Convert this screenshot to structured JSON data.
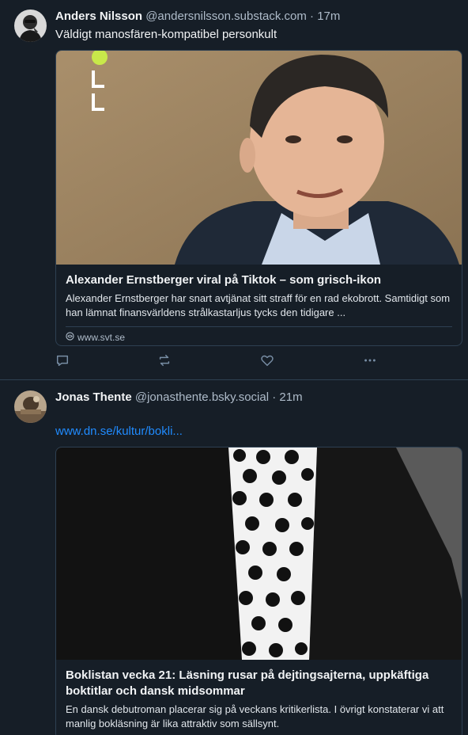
{
  "posts": [
    {
      "author": "Anders Nilsson",
      "handle": "@andersnilsson.substack.com",
      "separator": "·",
      "time": "17m",
      "text": "Väldigt manosfären-kompatibel personkult",
      "card": {
        "title": "Alexander Ernstberger viral på Tiktok – som grisch-ikon",
        "description": "Alexander Ernstberger har snart avtjänat sitt straff för en rad ekobrott. Samtidigt som han lämnat finansvärldens strålkastarljus tycks den tidigare ...",
        "domain": "www.svt.se"
      },
      "actions": [
        "reply-icon",
        "repost-icon",
        "like-icon",
        "more-icon"
      ]
    },
    {
      "author": "Jonas Thente",
      "handle": "@jonasthente.bsky.social",
      "separator": "·",
      "time": "21m",
      "link": "www.dn.se/kultur/bokli...",
      "card": {
        "title": "Boklistan vecka 21: Läsning rusar på dejtingsajterna, uppkäftiga boktitlar och dansk midsommar",
        "description": "En dansk debutroman placerar sig på veckans kritikerlista. I övrigt konstaterar vi att manlig bokläsning är lika attraktiv som sällsynt."
      }
    }
  ],
  "colors": {
    "background": "#161e27",
    "border": "#2e4052",
    "muted": "#aebbc9",
    "link": "#208bfe",
    "icon": "#788ea5"
  }
}
